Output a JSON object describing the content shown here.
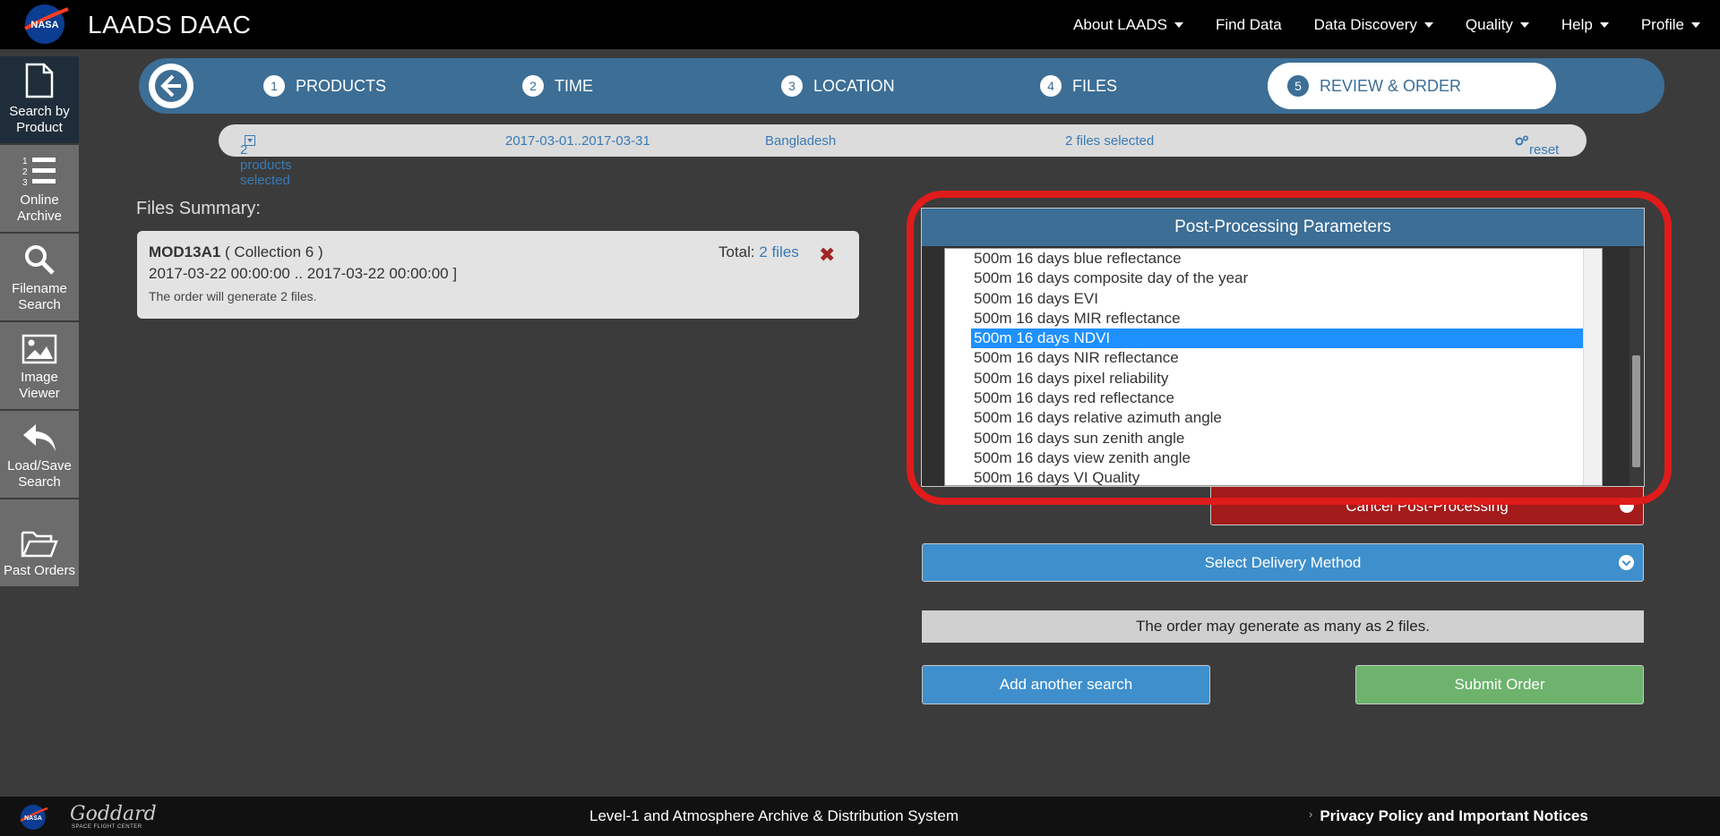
{
  "header": {
    "brand": "LAADS DAAC",
    "nav": [
      {
        "label": "About LAADS",
        "dropdown": true
      },
      {
        "label": "Find Data",
        "dropdown": false
      },
      {
        "label": "Data Discovery",
        "dropdown": true
      },
      {
        "label": "Quality",
        "dropdown": true
      },
      {
        "label": "Help",
        "dropdown": true
      },
      {
        "label": "Profile",
        "dropdown": true
      }
    ]
  },
  "sidebar": {
    "items": [
      {
        "label": "Search by Product",
        "icon": "file-icon",
        "active": true
      },
      {
        "label": "Online Archive",
        "icon": "numbered-list-icon",
        "active": false
      },
      {
        "label": "Filename Search",
        "icon": "search-icon",
        "active": false
      },
      {
        "label": "Image Viewer",
        "icon": "image-icon",
        "active": false
      },
      {
        "label": "Load/Save Search",
        "icon": "reply-arrow-icon",
        "active": false
      },
      {
        "label": "Past Orders",
        "icon": "folder-open-icon",
        "active": false
      }
    ]
  },
  "steps": [
    {
      "num": "1",
      "label": "PRODUCTS"
    },
    {
      "num": "2",
      "label": "TIME"
    },
    {
      "num": "3",
      "label": "LOCATION"
    },
    {
      "num": "4",
      "label": "FILES"
    },
    {
      "num": "5",
      "label": "REVIEW & ORDER",
      "active": true
    }
  ],
  "summary": {
    "products": "2 products selected",
    "dates": "2017-03-01..2017-03-31",
    "location": "Bangladesh",
    "files": "2 files selected",
    "reset": "reset"
  },
  "files_summary": {
    "title": "Files Summary:",
    "product": "MOD13A1",
    "collection": "( Collection 6 )",
    "daterange": "2017-03-22 00:00:00 .. 2017-03-22 00:00:00 ]",
    "note": "The order will generate 2 files.",
    "total_label": "Total:",
    "total_link": "2 files"
  },
  "post_processing": {
    "title": "Post-Processing Parameters",
    "options": [
      "500m 16 days blue reflectance",
      "500m 16 days composite day of the year",
      "500m 16 days EVI",
      "500m 16 days MIR reflectance",
      "500m 16 days NDVI",
      "500m 16 days NIR reflectance",
      "500m 16 days pixel reliability",
      "500m 16 days red reflectance",
      "500m 16 days relative azimuth angle",
      "500m 16 days sun zenith angle",
      "500m 16 days view zenith angle",
      "500m 16 days VI Quality"
    ],
    "selected": "500m 16 days NDVI",
    "cancel_label": "Cancel Post-Processing"
  },
  "delivery": {
    "label": "Select Delivery Method"
  },
  "order_info": "The order may generate as many as 2 files.",
  "buttons": {
    "add": "Add another search",
    "submit": "Submit Order"
  },
  "footer": {
    "goddard": "Goddard",
    "goddard_sub": "SPACE FLIGHT CENTER",
    "center": "Level-1 and Atmosphere Archive & Distribution System",
    "privacy": "Privacy Policy and Important Notices"
  },
  "colors": {
    "accent": "#3c6e96",
    "highlight_ring": "#e01b1b",
    "submit": "#6db36d",
    "cancel": "#a31b1b"
  }
}
